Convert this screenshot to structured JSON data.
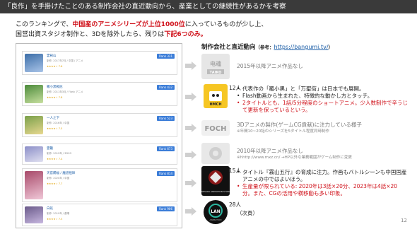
{
  "header": {
    "title": "「良作」を手掛けたことのある制作会社の直近動向から、産業としての継続性があるかを考察"
  },
  "intro": {
    "line1_pre": "このランキングで、",
    "line1_red": "中国産のアニメシリーズが上位1000位",
    "line1_post": "に入っているものが少し上、",
    "line2_pre": "国営出資スタジオ制作と、3Dを除外したら、残りは",
    "line2_red": "下記6つのみ。"
  },
  "ranking": [
    {
      "title": "霊剣山",
      "meta": "制作: 2017年7月 / 中国 / アニメ",
      "stars": "★★★★☆ 7.6",
      "rank": "Rank 331",
      "color": "#3c6ea8"
    },
    {
      "title": "羅小黒戦記",
      "meta": "制作: 2011年3月 / Flash アニメ",
      "stars": "★★★★☆ 7.8",
      "rank": "Rank 432",
      "color": "#4b8a3a"
    },
    {
      "title": "一人之下",
      "meta": "制作: 2016年 / 中国",
      "stars": "★★★★☆ 7.5",
      "rank": "Rank 523",
      "color": "#7aa04a"
    },
    {
      "title": "霊籠",
      "meta": "制作: 2019年 / 3DCG",
      "stars": "★★★★☆ 7.4",
      "rank": "Rank 673",
      "color": "#8c8fc8"
    },
    {
      "title": "天官賜福 / 魔道祖師",
      "meta": "制作: 2020年 / 中国",
      "stars": "★★★★☆ 7.7",
      "rank": "Rank 814",
      "color": "#a84a6a"
    },
    {
      "title": "白蛇",
      "meta": "制作: 2019年 / 劇場",
      "stars": "★★★★☆ 7.3",
      "rank": "Rank 906",
      "color": "#6a5a8a"
    }
  ],
  "section": {
    "title": "制作会社と直近動向",
    "ref": "（参考：",
    "link": "https://bangumi.tv/",
    "ref_end": "）"
  },
  "companies": [
    {
      "logo": "电魂 TAIKO",
      "count": "",
      "lines": [
        "2015年以降アニメ作品なし"
      ]
    },
    {
      "logo": "HMCH",
      "count": "12人",
      "bullets": [
        "代表作の「羅小黒」と「万聖街」は日本でも展開。",
        "Flash動画から生まれた、特徴的な動かし方とタッチ。"
      ],
      "red_bullet": "2タイトルとも、1話/5分程度のショートアニメ。少人数制作で辛うじて更新を保っているという。"
    },
    {
      "logo": "FOCH",
      "count": "",
      "lines": [
        "3Dアニメの製作(ゲームCG貢献)に注力している様子"
      ],
      "sub": "※年間10~20話のシリーズを5タイトル程度同時制作"
    },
    {
      "logo": "",
      "count": "",
      "lines": [
        "2010年以降アニメ作品なし"
      ],
      "sub": "※hhttp://www.mxz.cn/ →HP以外な業務範囲がゲーム制作に変更"
    },
    {
      "logo": "SAMSARA ANIMATION STUDIO",
      "count": "15人",
      "bullets": [
        "タイトル『霧山五行』の育成に注力。作画もバトルシーンも中国国産アニメの中ではよいほう。"
      ],
      "red_bullet": "生産量が限られている: 2020年は3話×20分、2023年は4話×20分。また、CGの活用や横移動も多い印象。"
    },
    {
      "logo": "LAN ANIMATION",
      "count": "28人",
      "lines": [
        "（次頁）"
      ]
    }
  ],
  "page_number": "12"
}
